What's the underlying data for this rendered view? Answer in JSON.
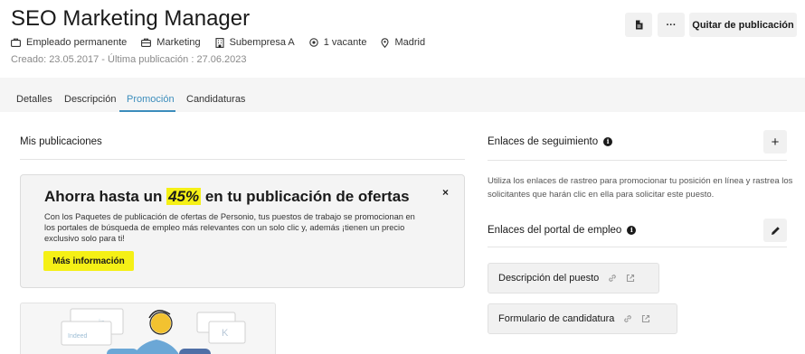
{
  "header": {
    "title": "SEO Marketing Manager",
    "meta": {
      "employment": "Empleado permanente",
      "department": "Marketing",
      "subcompany": "Subempresa A",
      "vacancies": "1 vacante",
      "location": "Madrid"
    },
    "dates": "Creado: 23.05.2017 - Última publicación : 27.06.2023",
    "more_label": "···",
    "unpublish_label": "Quitar de publicación"
  },
  "tabs": [
    {
      "label": "Detalles"
    },
    {
      "label": "Descripción"
    },
    {
      "label": "Promoción"
    },
    {
      "label": "Candidaturas"
    }
  ],
  "publications": {
    "title": "Mis publicaciones",
    "promo": {
      "heading_before": "Ahorra hasta un ",
      "heading_highlight": "45%",
      "heading_after": " en tu publicación de ofertas",
      "close": "×",
      "body": "Con los Paquetes de publicación de ofertas de Personio, tus puestos de trabajo se promocionan en los portales de búsqueda de empleo más relevantes con un solo clic y, además ¡tienen un precio exclusivo solo para ti!",
      "button": "Más información"
    },
    "illustration": {
      "labels": [
        "in",
        "Indeed"
      ]
    }
  },
  "tracking": {
    "title": "Enlaces de seguimiento",
    "add": "+",
    "description": "Utiliza los enlaces de rastreo para promocionar tu posición en línea y rastrea los solicitantes que harán clic en ella para solicitar este puesto."
  },
  "portal": {
    "title": "Enlaces del portal de empleo",
    "links": [
      {
        "label": "Descripción del puesto"
      },
      {
        "label": "Formulario de candidatura"
      }
    ]
  },
  "colors": {
    "accent": "#3c8dbc",
    "highlight": "#f5f016"
  }
}
